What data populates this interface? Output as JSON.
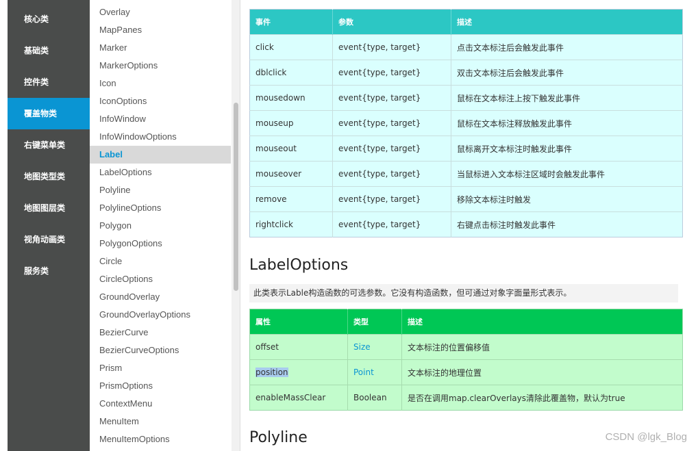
{
  "categories": [
    "核心类",
    "基础类",
    "控件类",
    "覆盖物类",
    "右键菜单类",
    "地图类型类",
    "地图图层类",
    "视角动画类",
    "服务类"
  ],
  "active_category": "覆盖物类",
  "class_list": [
    "Overlay",
    "MapPanes",
    "Marker",
    "MarkerOptions",
    "Icon",
    "IconOptions",
    "InfoWindow",
    "InfoWindowOptions",
    "Label",
    "LabelOptions",
    "Polyline",
    "PolylineOptions",
    "Polygon",
    "PolygonOptions",
    "Circle",
    "CircleOptions",
    "GroundOverlay",
    "GroundOverlayOptions",
    "BezierCurve",
    "BezierCurveOptions",
    "Prism",
    "PrismOptions",
    "ContextMenu",
    "MenuItem",
    "MenuItemOptions"
  ],
  "active_class": "Label",
  "events_table": {
    "headers": [
      "事件",
      "参数",
      "描述"
    ],
    "rows": [
      [
        "click",
        "event{type, target}",
        "点击文本标注后会触发此事件"
      ],
      [
        "dblclick",
        "event{type, target}",
        "双击文本标注后会触发此事件"
      ],
      [
        "mousedown",
        "event{type, target}",
        "鼠标在文本标注上按下触发此事件"
      ],
      [
        "mouseup",
        "event{type, target}",
        "鼠标在文本标注释放触发此事件"
      ],
      [
        "mouseout",
        "event{type, target}",
        "鼠标离开文本标注时触发此事件"
      ],
      [
        "mouseover",
        "event{type, target}",
        "当鼠标进入文本标注区域时会触发此事件"
      ],
      [
        "remove",
        "event{type, target}",
        "移除文本标注时触发"
      ],
      [
        "rightclick",
        "event{type, target}",
        "右键点击标注时触发此事件"
      ]
    ]
  },
  "label_options": {
    "title": "LabelOptions",
    "description": "此类表示Lable构造函数的可选参数。它没有构造函数，但可通过对象字面量形式表示。",
    "headers": [
      "属性",
      "类型",
      "描述"
    ],
    "rows": [
      {
        "name": "offset",
        "type": "Size",
        "type_is_link": true,
        "desc": "文本标注的位置偏移值"
      },
      {
        "name": "position",
        "type": "Point",
        "type_is_link": true,
        "desc": "文本标注的地理位置",
        "name_highlighted": true
      },
      {
        "name": "enableMassClear",
        "type": "Boolean",
        "type_is_link": false,
        "desc": "是否在调用map.clearOverlays清除此覆盖物，默认为true"
      }
    ]
  },
  "next_section_title": "Polyline",
  "watermark": "CSDN @lgk_Blog",
  "colors": {
    "category_bg": "#4a4c4b",
    "category_active": "#0a95d3",
    "event_header": "#2cc7c4",
    "event_row": "#dafffe",
    "option_header": "#00c755",
    "option_row": "#c2fccc",
    "link": "#0a95d3"
  }
}
